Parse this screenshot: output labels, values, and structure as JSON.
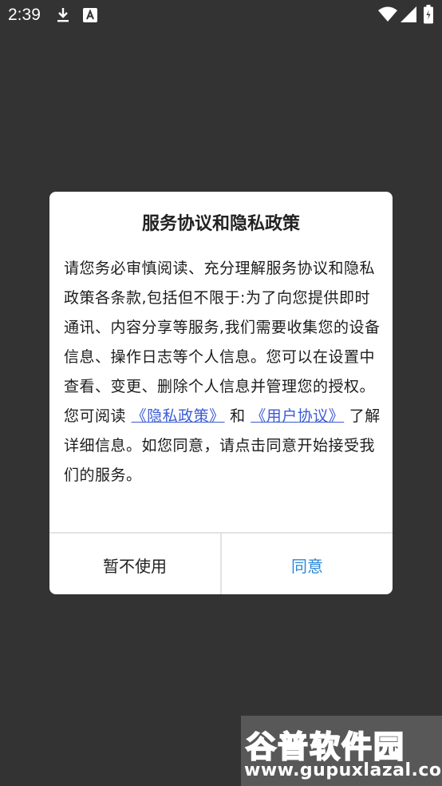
{
  "status_bar": {
    "time": "2:39",
    "icons": [
      "download-icon",
      "keyboard-a-icon",
      "wifi-icon",
      "signal-icon",
      "battery-icon"
    ]
  },
  "dialog": {
    "title": "服务协议和隐私政策",
    "paragraph1": "请您务必审慎阅读、充分理解服务协议和隐私政策各条款,包括但不限于:为了向您提供即时通讯、内容分享等服务,我们需要收集您的设备信息、操作日志等个人信息。您可以在设置中查看、变更、删除个人信息并管理您的授权。",
    "p2_prefix": "您可阅读",
    "privacy_link": "《隐私政策》",
    "p2_and": "和",
    "user_agreement_link": "《用户协议》",
    "p2_suffix": "了解详细信息。如您同意，请点击同意开始接受我们的服务。",
    "cancel_label": "暂不使用",
    "agree_label": "同意"
  },
  "watermark": {
    "cn": "谷普软件园",
    "en": "www.gupuxlazal.com"
  },
  "colors": {
    "background": "#333333",
    "link": "#3b5bd6",
    "agree": "#2a87d8"
  }
}
